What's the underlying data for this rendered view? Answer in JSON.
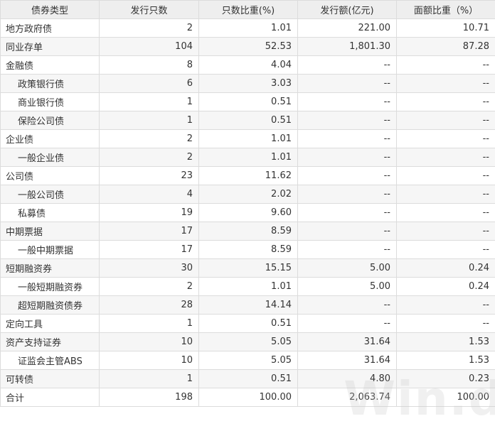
{
  "headers": [
    "债券类型",
    "发行只数",
    "只数比重(%)",
    "发行额(亿元)",
    "面额比重（%）"
  ],
  "rows": [
    {
      "name": "地方政府债",
      "sub": false,
      "count": "2",
      "count_pct": "1.01",
      "amount": "221.00",
      "amount_pct": "10.71"
    },
    {
      "name": "同业存单",
      "sub": false,
      "count": "104",
      "count_pct": "52.53",
      "amount": "1,801.30",
      "amount_pct": "87.28"
    },
    {
      "name": "金融债",
      "sub": false,
      "count": "8",
      "count_pct": "4.04",
      "amount": "--",
      "amount_pct": "--"
    },
    {
      "name": "政策银行债",
      "sub": true,
      "count": "6",
      "count_pct": "3.03",
      "amount": "--",
      "amount_pct": "--"
    },
    {
      "name": "商业银行债",
      "sub": true,
      "count": "1",
      "count_pct": "0.51",
      "amount": "--",
      "amount_pct": "--"
    },
    {
      "name": "保险公司债",
      "sub": true,
      "count": "1",
      "count_pct": "0.51",
      "amount": "--",
      "amount_pct": "--"
    },
    {
      "name": "企业债",
      "sub": false,
      "count": "2",
      "count_pct": "1.01",
      "amount": "--",
      "amount_pct": "--"
    },
    {
      "name": "一般企业债",
      "sub": true,
      "count": "2",
      "count_pct": "1.01",
      "amount": "--",
      "amount_pct": "--"
    },
    {
      "name": "公司债",
      "sub": false,
      "count": "23",
      "count_pct": "11.62",
      "amount": "--",
      "amount_pct": "--"
    },
    {
      "name": "一般公司债",
      "sub": true,
      "count": "4",
      "count_pct": "2.02",
      "amount": "--",
      "amount_pct": "--"
    },
    {
      "name": "私募债",
      "sub": true,
      "count": "19",
      "count_pct": "9.60",
      "amount": "--",
      "amount_pct": "--"
    },
    {
      "name": "中期票据",
      "sub": false,
      "count": "17",
      "count_pct": "8.59",
      "amount": "--",
      "amount_pct": "--"
    },
    {
      "name": "一般中期票据",
      "sub": true,
      "count": "17",
      "count_pct": "8.59",
      "amount": "--",
      "amount_pct": "--"
    },
    {
      "name": "短期融资券",
      "sub": false,
      "count": "30",
      "count_pct": "15.15",
      "amount": "5.00",
      "amount_pct": "0.24"
    },
    {
      "name": "一般短期融资券",
      "sub": true,
      "count": "2",
      "count_pct": "1.01",
      "amount": "5.00",
      "amount_pct": "0.24"
    },
    {
      "name": "超短期融资债券",
      "sub": true,
      "count": "28",
      "count_pct": "14.14",
      "amount": "--",
      "amount_pct": "--"
    },
    {
      "name": "定向工具",
      "sub": false,
      "count": "1",
      "count_pct": "0.51",
      "amount": "--",
      "amount_pct": "--"
    },
    {
      "name": "资产支持证券",
      "sub": false,
      "count": "10",
      "count_pct": "5.05",
      "amount": "31.64",
      "amount_pct": "1.53"
    },
    {
      "name": "证监会主管ABS",
      "sub": true,
      "count": "10",
      "count_pct": "5.05",
      "amount": "31.64",
      "amount_pct": "1.53"
    },
    {
      "name": "可转债",
      "sub": false,
      "count": "1",
      "count_pct": "0.51",
      "amount": "4.80",
      "amount_pct": "0.23"
    },
    {
      "name": "合计",
      "sub": false,
      "count": "198",
      "count_pct": "100.00",
      "amount": "2,063.74",
      "amount_pct": "100.00"
    }
  ],
  "watermark": "Win.d"
}
